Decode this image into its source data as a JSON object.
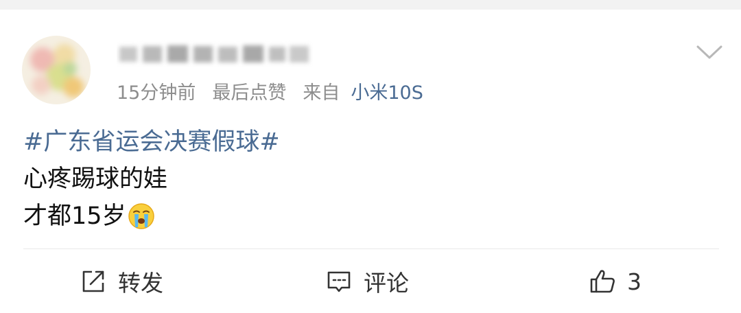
{
  "post": {
    "meta": {
      "time": "15分钟前",
      "last_like": "最后点赞",
      "from_label": "来自",
      "source": "小米10S"
    },
    "content": {
      "hashtag": "#广东省运会决赛假球#",
      "line2": "心疼踢球的娃",
      "line3": "才都15岁",
      "emoji": "crying-face"
    },
    "actions": {
      "repost_label": "转发",
      "comment_label": "评论",
      "like_count": "3"
    },
    "icons": {
      "avatar": "blurred-avatar",
      "username": "blurred-username",
      "dropdown": "chevron-down-icon",
      "repost": "share-external-icon",
      "comment": "comment-bubble-icon",
      "like": "thumbs-up-icon"
    },
    "colors": {
      "link": "#4a6b93",
      "meta_gray": "#8d8d8d",
      "text": "#111111",
      "divider": "#e9e9e9"
    }
  }
}
